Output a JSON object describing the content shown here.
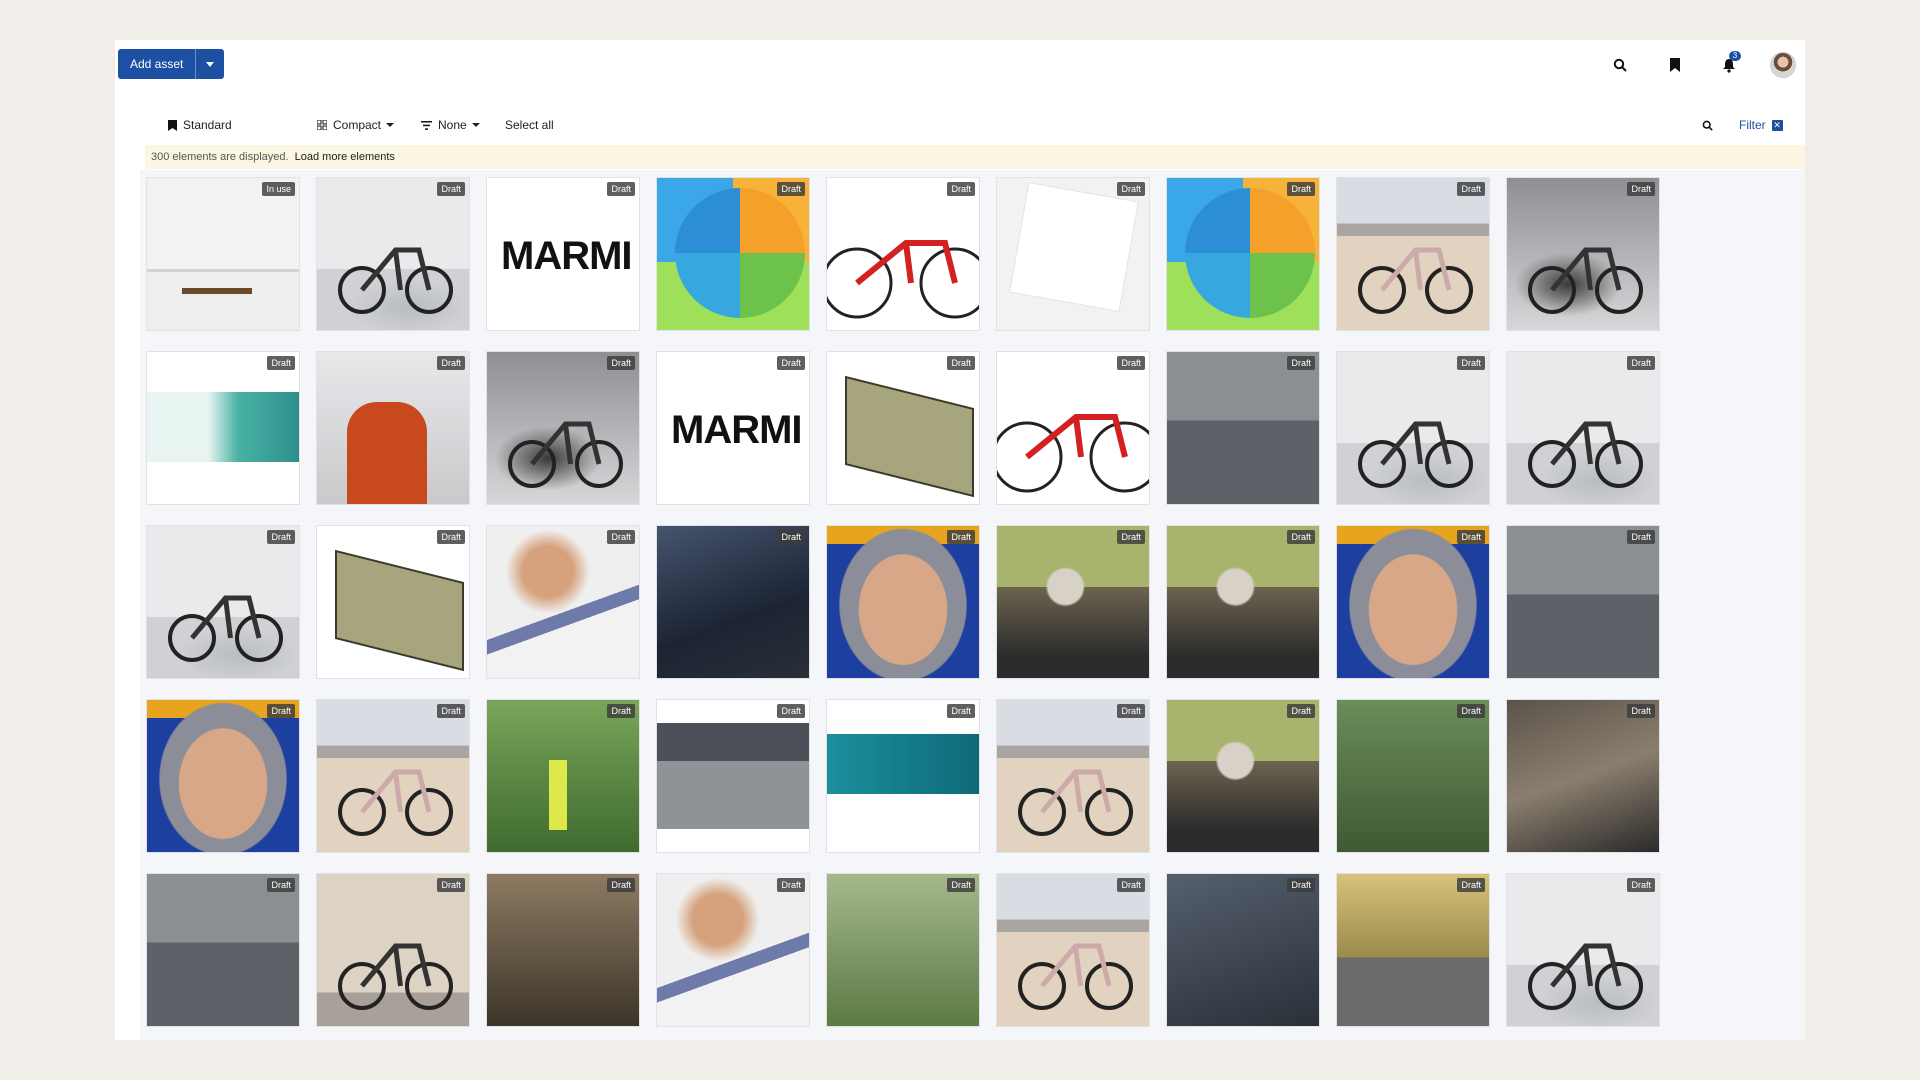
{
  "header": {
    "add_asset_label": "Add asset",
    "notification_count": "3",
    "icons": [
      "search-icon",
      "bookmark-icon",
      "bell-icon"
    ]
  },
  "toolbar": {
    "standard_label": "Standard",
    "view_label": "Compact",
    "group_label": "None",
    "select_all_label": "Select all",
    "filter_label": "Filter"
  },
  "info": {
    "count_text": "300 elements are displayed.",
    "load_more_label": "Load more elements"
  },
  "colors": {
    "accent": "#1d4fa3",
    "info_bg": "#fbf6e2"
  },
  "assets": [
    {
      "status": "In use",
      "thumb": "office"
    },
    {
      "status": "Draft",
      "thumb": "bike-hand"
    },
    {
      "status": "Draft",
      "thumb": "marmi",
      "text": "MARMI"
    },
    {
      "status": "Draft",
      "thumb": "pie"
    },
    {
      "status": "Draft",
      "thumb": "road"
    },
    {
      "status": "Draft",
      "thumb": "blank"
    },
    {
      "status": "Draft",
      "thumb": "pie"
    },
    {
      "status": "Draft",
      "thumb": "desert"
    },
    {
      "status": "Draft",
      "thumb": "bike-dark"
    },
    {
      "status": "Draft",
      "thumb": "banner"
    },
    {
      "status": "Draft",
      "thumb": "speaker"
    },
    {
      "status": "Draft",
      "thumb": "bike-dark"
    },
    {
      "status": "Draft",
      "thumb": "marmi",
      "text": "MARMI"
    },
    {
      "status": "Draft",
      "thumb": "cad"
    },
    {
      "status": "Draft",
      "thumb": "road"
    },
    {
      "status": "Draft",
      "thumb": "couple"
    },
    {
      "status": "Draft",
      "thumb": "bike-hand"
    },
    {
      "status": "Draft",
      "thumb": "bike-hand"
    },
    {
      "status": "Draft",
      "thumb": "bike-hand"
    },
    {
      "status": "Draft",
      "thumb": "cad"
    },
    {
      "status": "Draft",
      "thumb": "blur"
    },
    {
      "status": "Draft",
      "thumb": "jacket"
    },
    {
      "status": "Draft",
      "thumb": "face"
    },
    {
      "status": "Draft",
      "thumb": "senior"
    },
    {
      "status": "Draft",
      "thumb": "senior"
    },
    {
      "status": "Draft",
      "thumb": "face"
    },
    {
      "status": "Draft",
      "thumb": "couple"
    },
    {
      "status": "Draft",
      "thumb": "face"
    },
    {
      "status": "Draft",
      "thumb": "desert"
    },
    {
      "status": "Draft",
      "thumb": "scooter"
    },
    {
      "status": "Draft",
      "thumb": "kids"
    },
    {
      "status": "Draft",
      "thumb": "teal"
    },
    {
      "status": "Draft",
      "thumb": "desert"
    },
    {
      "status": "Draft",
      "thumb": "senior"
    },
    {
      "status": "Draft",
      "thumb": "forest"
    },
    {
      "status": "Draft",
      "thumb": "gloves"
    },
    {
      "status": "Draft",
      "thumb": "couple"
    },
    {
      "status": "Draft",
      "thumb": "ebike"
    },
    {
      "status": "Draft",
      "thumb": "fatbike"
    },
    {
      "status": "Draft",
      "thumb": "blur"
    },
    {
      "status": "Draft",
      "thumb": "garden"
    },
    {
      "status": "Draft",
      "thumb": "desert"
    },
    {
      "status": "Draft",
      "thumb": "woman"
    },
    {
      "status": "Draft",
      "thumb": "autumn"
    },
    {
      "status": "Draft",
      "thumb": "bike-hand"
    }
  ]
}
